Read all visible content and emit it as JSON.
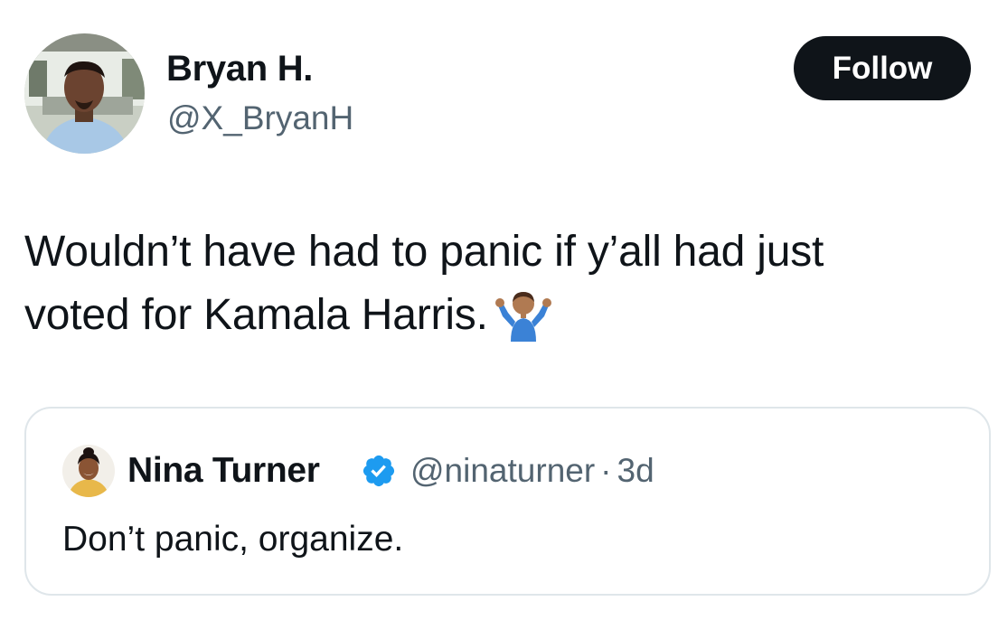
{
  "author": {
    "name": "Bryan H.",
    "handle": "@X_BryanH"
  },
  "follow_label": "Follow",
  "tweet": {
    "lines": [
      "Wouldn’t have had to panic if y’all had just",
      "voted for Kamala Harris."
    ],
    "emoji_icon": "person-shrugging-emoji"
  },
  "quote": {
    "name": "Nina Turner",
    "verified_icon": "verified-badge-icon",
    "handle": "@ninaturner",
    "separator": "·",
    "age": "3d",
    "text": "Don’t panic, organize."
  },
  "colors": {
    "text": "#0f1419",
    "secondary": "#536471",
    "follow_bg": "#0f1419",
    "follow_text": "#ffffff",
    "verified": "#1d9bf0",
    "card_border": "#dfe6ea"
  }
}
